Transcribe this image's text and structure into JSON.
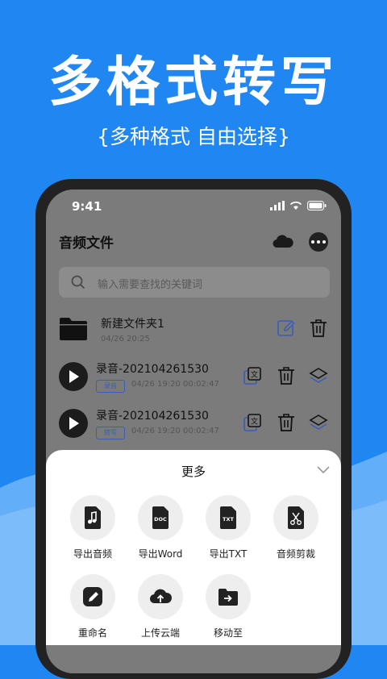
{
  "colors": {
    "brand_blue": "#1f86f2",
    "light_blue": "#62aef8",
    "tag_blue": "#3a5db8"
  },
  "banner": {
    "headline": "多格式转写",
    "subline": "{多种格式 自由选择}"
  },
  "status_bar": {
    "time": "9:41"
  },
  "header": {
    "title": "音频文件",
    "cloud_icon": "cloud-icon",
    "more_icon": "more-icon"
  },
  "search": {
    "placeholder": "输入需要查找的关键词"
  },
  "files": [
    {
      "type": "folder",
      "name": "新建文件夹1",
      "date": "04/26 20:25"
    },
    {
      "type": "audio",
      "name": "录音-202104261530",
      "tag": "录音",
      "meta": "04/26 19:20  00:02:47"
    },
    {
      "type": "audio",
      "name": "录音-202104261530",
      "tag": "转写",
      "meta": "04/26 19:20  00:02:47"
    }
  ],
  "sheet": {
    "title": "更多",
    "options": [
      {
        "label": "导出音频",
        "icon": "music-file-icon"
      },
      {
        "label": "导出Word",
        "icon": "doc-file-icon",
        "badge": "DOC"
      },
      {
        "label": "导出TXT",
        "icon": "txt-file-icon",
        "badge": "TXT"
      },
      {
        "label": "音频剪裁",
        "icon": "scissors-file-icon"
      },
      {
        "label": "重命名",
        "icon": "pencil-icon"
      },
      {
        "label": "上传云端",
        "icon": "cloud-upload-icon"
      },
      {
        "label": "移动至",
        "icon": "move-folder-icon"
      }
    ]
  }
}
